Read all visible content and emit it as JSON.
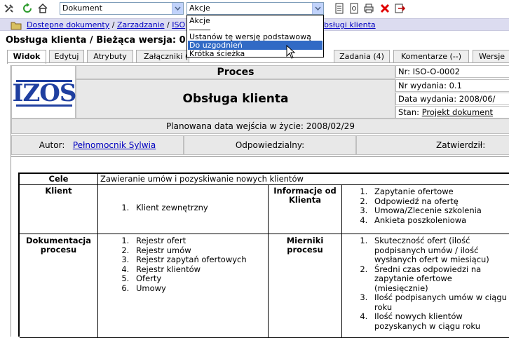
{
  "toolbar": {
    "document_select": "Dokument",
    "action_select": "Akcje"
  },
  "breadcrumb": {
    "items": [
      "Dostepne dokumenty",
      "Zarzadzanie",
      "ISO",
      "bsługi klienta"
    ],
    "separator": " / "
  },
  "page_title": "Obsługa klienta / Bieżąca wersja: 0",
  "tabs": [
    "Widok",
    "Edytuj",
    "Atrybuty",
    "Załączniki (",
    "Zadania (4)",
    "Komentarze (--)",
    "Wersje"
  ],
  "dropdown": {
    "items": [
      "Akcje",
      "______",
      "Ustanów tę wersję podstawową",
      "Do uzgodnień",
      "Krótka ścieżka"
    ],
    "highlighted_index": 3
  },
  "header": {
    "logo_text": "IZOS",
    "type": "Proces",
    "name": "Obsługa klienta",
    "nr": "Nr: ISO-O-0002",
    "nr_wydania": "Nr wydania:  0.1",
    "data_wydania": "Data wydania: 2008/06/",
    "stan_label": "Stan: ",
    "stan_value": "Projekt dokument",
    "planned_date": "Planowana data wejścia w życie: 2008/02/29",
    "autor_label": "Autor:",
    "autor_value": "Pełnomocnik Sylwia",
    "odpowiedzialny_label": "Odpowiedzialny:",
    "zatwierdzil_label": "Zatwierdził:"
  },
  "content": {
    "cele_label": "Cele",
    "cele_value": "Zawieranie umów i pozyskiwanie nowych klientów",
    "klient_label": "Klient",
    "klient_items": [
      "Klient zewnętrzny"
    ],
    "informacje_label": "Informacje od Klienta",
    "informacje_items": [
      "Zapytanie ofertowe",
      "Odpowiedź na ofertę",
      "Umowa/Zlecenie szkolenia",
      "Ankieta poszkoleniowa"
    ],
    "dokumentacja_label": "Dokumentacja procesu",
    "dokumentacja_items": [
      "Rejestr ofert",
      "Rejestr umów",
      "Rejestr zapytań ofertowych",
      "Rejestr klientów",
      "Oferty",
      "Umowy"
    ],
    "mierniki_label": "Mierniki procesu",
    "mierniki_items": [
      "Skuteczność ofert (ilość podpisanych umów / ilość wysłanych ofert w miesiącu)",
      "Średni czas odpowiedzi na zapytanie ofertowe (miesięcznie)",
      "Ilość podpisanych umów w ciągu roku",
      "Ilość nowych klientów pozyskanych w ciągu roku"
    ]
  },
  "colors": {
    "breadcrumb_bg": "#dcdcf0",
    "link": "#0000c0",
    "logo": "#1f3fa0",
    "highlight": "#316ac5",
    "delete_icon": "#e00000"
  }
}
